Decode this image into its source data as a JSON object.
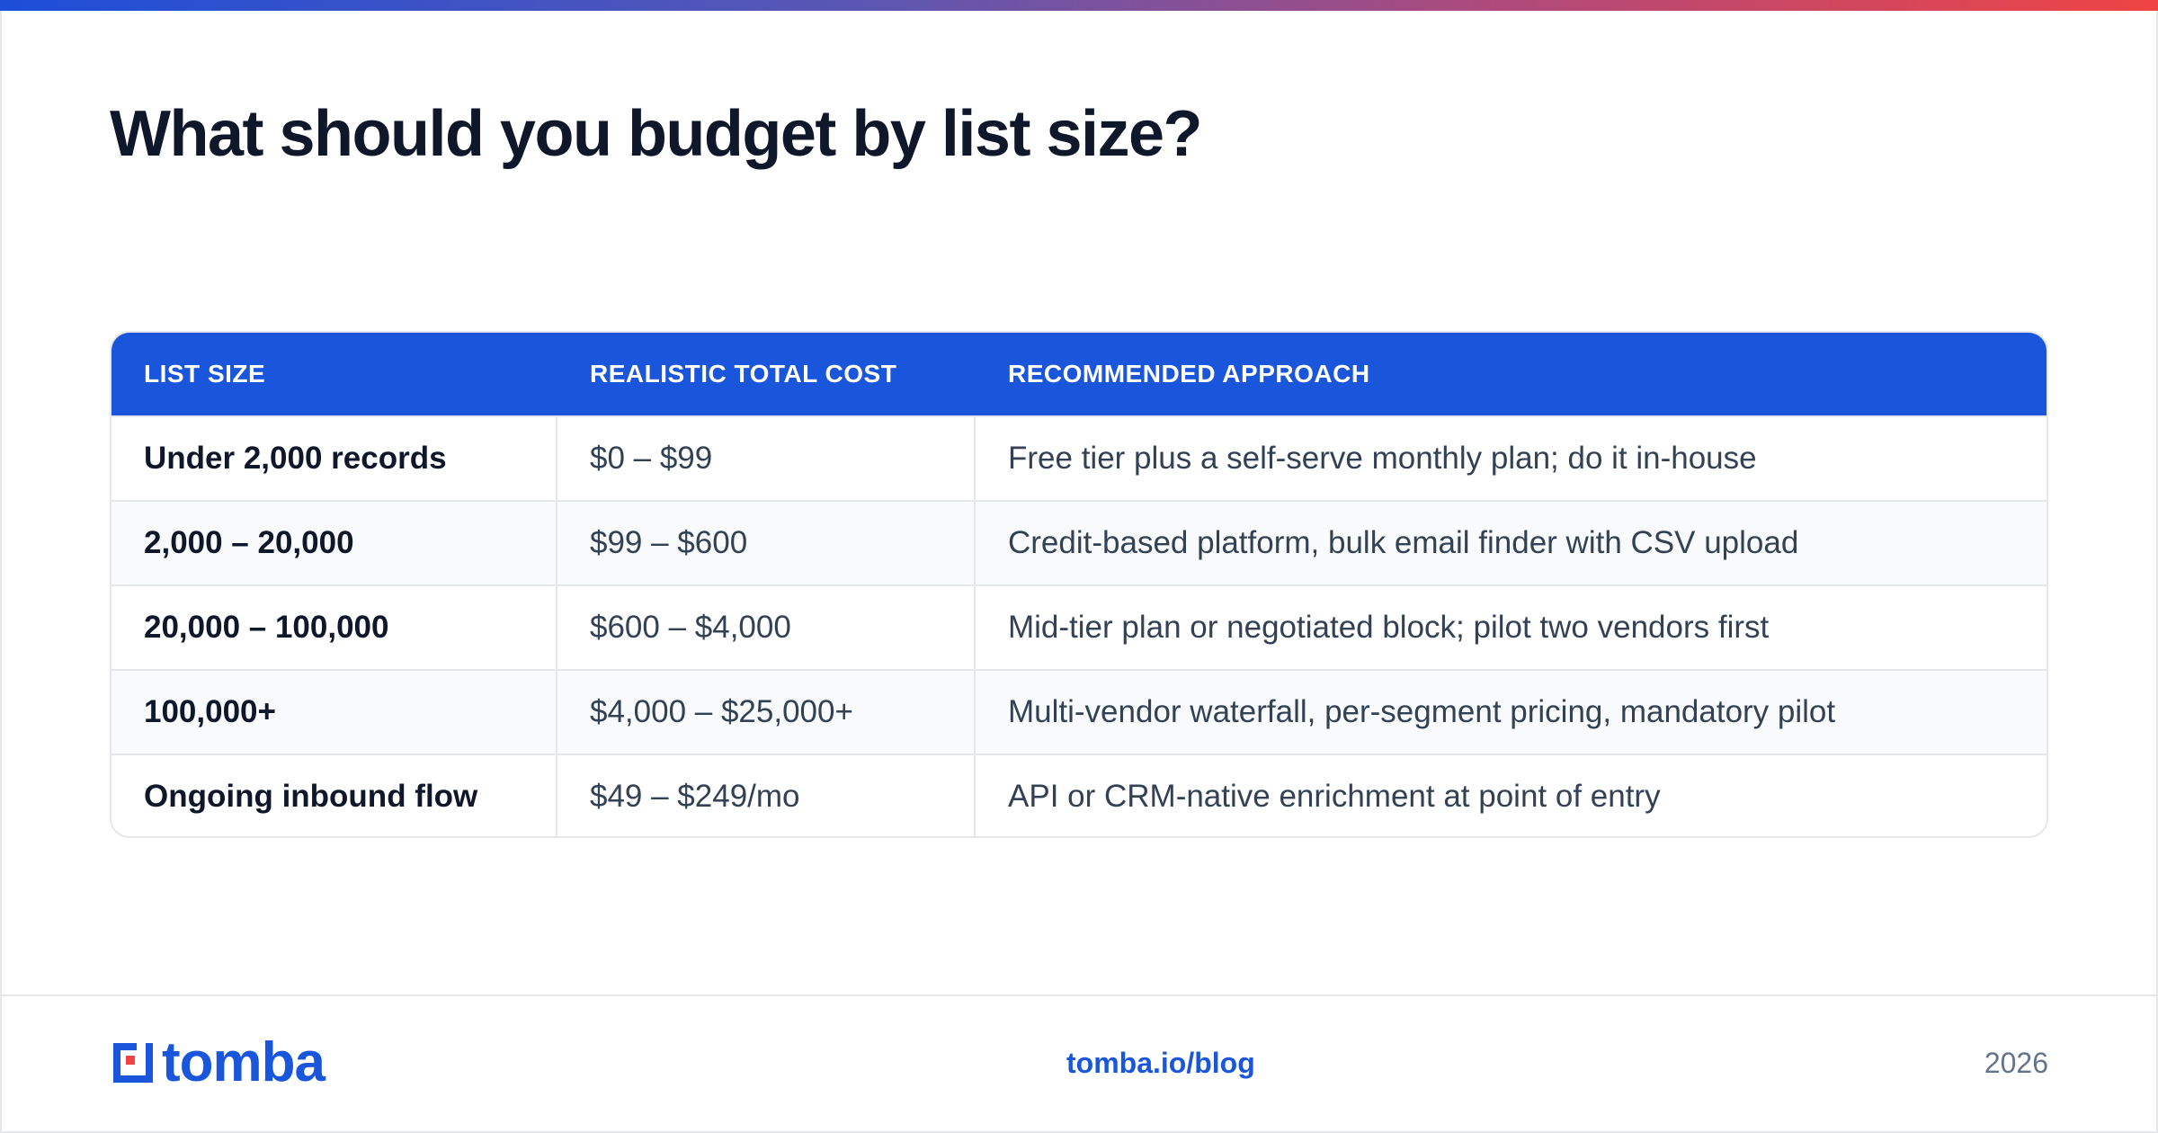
{
  "title": "What should you budget by list size?",
  "table": {
    "headers": [
      "LIST SIZE",
      "REALISTIC TOTAL COST",
      "RECOMMENDED APPROACH"
    ],
    "rows": [
      [
        "Under 2,000 records",
        "$0 – $99",
        "Free tier plus a self-serve monthly plan; do it in-house"
      ],
      [
        "2,000 – 20,000",
        "$99 – $600",
        "Credit-based platform, bulk email finder with CSV upload"
      ],
      [
        "20,000 – 100,000",
        "$600 – $4,000",
        "Mid-tier plan or negotiated block; pilot two vendors first"
      ],
      [
        "100,000+",
        "$4,000 – $25,000+",
        "Multi-vendor waterfall, per-segment pricing, mandatory pilot"
      ],
      [
        "Ongoing inbound flow",
        "$49 – $249/mo",
        "API or CRM-native enrichment at point of entry"
      ]
    ]
  },
  "footer": {
    "logo_text": "tomba",
    "link": "tomba.io/blog",
    "year": "2026"
  },
  "colors": {
    "brand": "#1a56db",
    "accent_red": "#ef4444",
    "title": "#0f172a"
  },
  "icons": {
    "logo": "tomba-logo-icon"
  }
}
